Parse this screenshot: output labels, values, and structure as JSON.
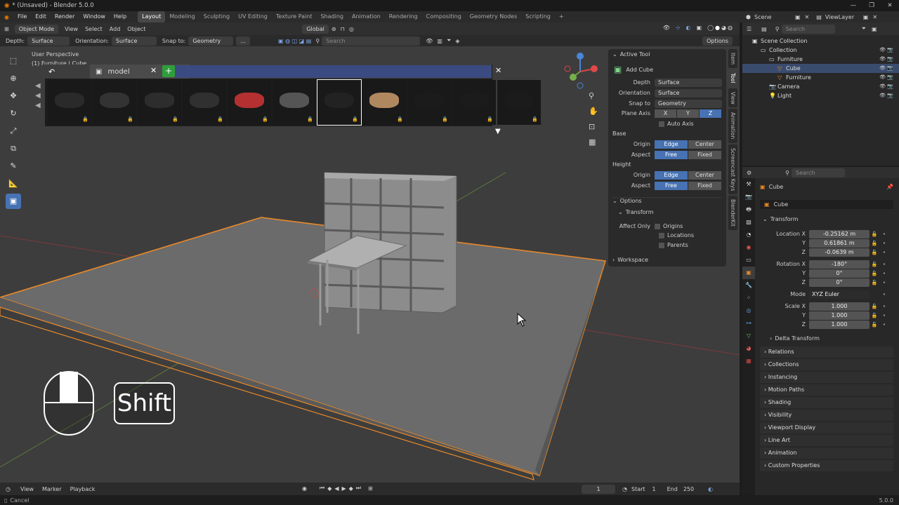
{
  "window": {
    "title": "* (Unsaved) - Blender 5.0.0",
    "controls": [
      "—",
      "❐",
      "✕"
    ]
  },
  "menu": [
    "File",
    "Edit",
    "Render",
    "Window",
    "Help"
  ],
  "workspaces": [
    "Layout",
    "Modeling",
    "Sculpting",
    "UV Editing",
    "Texture Paint",
    "Shading",
    "Animation",
    "Rendering",
    "Compositing",
    "Geometry Nodes",
    "Scripting"
  ],
  "active_workspace": "Layout",
  "scene": {
    "scene_label": "Scene",
    "view_layer_label": "ViewLayer"
  },
  "viewport_header": {
    "mode": "Object Mode",
    "menus": [
      "View",
      "Select",
      "Add",
      "Object"
    ],
    "transform_orientation": "Global",
    "depth_label": "Depth:",
    "depth_value": "Surface",
    "orientation_label": "Orientation:",
    "orientation_value": "Surface",
    "snap_label": "Snap to:",
    "snap_value": "Geometry",
    "more": "...",
    "search_placeholder": "Search",
    "options": "Options"
  },
  "viewport": {
    "view_name": "User Perspective",
    "collection_info": "(1) Furniture | Cube"
  },
  "asset_browser": {
    "search_value": "model",
    "thumbnail_count": 11,
    "active_thumb_index": 6
  },
  "overlay": {
    "key_label": "Shift"
  },
  "tool_panel": {
    "title": "Active Tool",
    "tool_name": "Add Cube",
    "depth_label": "Depth",
    "depth": "Surface",
    "orientation_label": "Orientation",
    "orientation": "Surface",
    "snap_label": "Snap to",
    "snap": "Geometry",
    "plane_axis_label": "Plane Axis",
    "axes": [
      "X",
      "Y",
      "Z"
    ],
    "active_axis": "Z",
    "auto_axis": "Auto Axis",
    "base_label": "Base",
    "height_label": "Height",
    "origin_label": "Origin",
    "aspect_label": "Aspect",
    "edge": "Edge",
    "center": "Center",
    "free": "Free",
    "fixed": "Fixed",
    "options_label": "Options",
    "transform_label": "Transform",
    "affect_only_label": "Affect Only",
    "origins": "Origins",
    "locations": "Locations",
    "parents": "Parents",
    "workspace_label": "Workspace"
  },
  "side_tabs": [
    "Item",
    "Tool",
    "View",
    "Animation",
    "Screencast Keys",
    "BlenderKit"
  ],
  "timeline": {
    "menus": [
      "View",
      "Marker",
      "Playback"
    ],
    "current_frame": "1",
    "start_label": "Start",
    "start": "1",
    "end_label": "End",
    "end": "250"
  },
  "status": {
    "left": "Cancel",
    "version": "5.0.0"
  },
  "outliner": {
    "search_placeholder": "Search",
    "items": [
      {
        "label": "Scene Collection",
        "depth": 0
      },
      {
        "label": "Collection",
        "depth": 1
      },
      {
        "label": "Furniture",
        "depth": 2
      },
      {
        "label": "Cube",
        "depth": 3,
        "selected": true
      },
      {
        "label": "Furniture",
        "depth": 3
      },
      {
        "label": "Camera",
        "depth": 2
      },
      {
        "label": "Light",
        "depth": 2
      }
    ]
  },
  "properties": {
    "search_placeholder": "Search",
    "object_name": "Cube",
    "data_name": "Cube",
    "transform_label": "Transform",
    "location_label": "Location X",
    "location": [
      "-0.25162 m",
      "0.61861 m",
      "-0.0639 m"
    ],
    "rotation_label": "Rotation X",
    "rotation": [
      "-180°",
      "0°",
      "0°"
    ],
    "mode_label": "Mode",
    "mode": "XYZ Euler",
    "scale_label": "Scale X",
    "scale": [
      "1.000",
      "1.000",
      "1.000"
    ],
    "axis_y": "Y",
    "axis_z": "Z",
    "delta_transform": "Delta Transform",
    "sections": [
      "Relations",
      "Collections",
      "Instancing",
      "Motion Paths",
      "Shading",
      "Visibility",
      "Viewport Display",
      "Line Art",
      "Animation",
      "Custom Properties"
    ]
  },
  "colors": {
    "accent": "#4772b3",
    "selection_outline": "#e8892a",
    "grid_x": "#8a3a3a",
    "grid_y": "#6a8a3a"
  }
}
